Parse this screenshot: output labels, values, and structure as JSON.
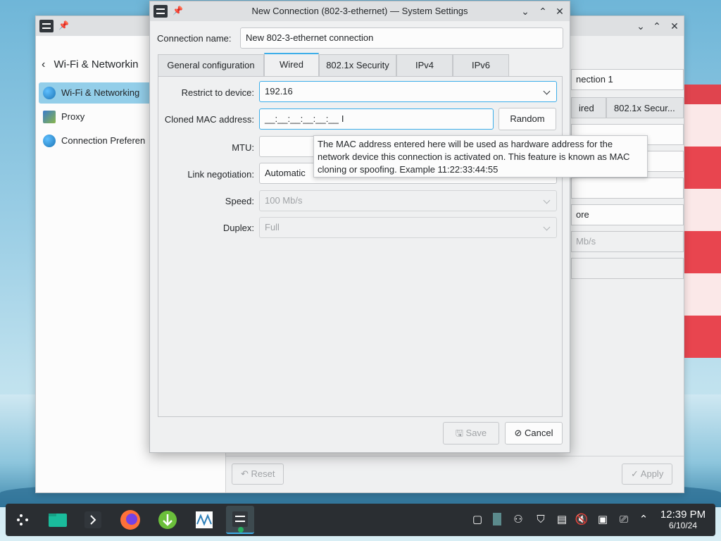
{
  "background_window": {
    "sidebar_title": "Wi-Fi & Networkin",
    "sidebar_items": [
      {
        "label": "Wi-Fi & Networking",
        "icon": "network-icon",
        "active": true
      },
      {
        "label": "Proxy",
        "icon": "proxy-icon",
        "active": false
      },
      {
        "label": "Connection Preferen",
        "icon": "globe-icon",
        "active": false
      }
    ],
    "right_peek": {
      "connection_name": "nection 1",
      "tab_wired": "ired",
      "tab_security": "802.1x Secur...",
      "field_more": "ore",
      "speed": "Mb/s"
    },
    "reset_label": "Reset",
    "apply_label": "Apply"
  },
  "dialog": {
    "title": "New Connection (802-3-ethernet) — System Settings",
    "connection_name_label": "Connection name:",
    "connection_name_value": "New 802-3-ethernet connection",
    "tabs": [
      {
        "label": "General configuration",
        "active": false
      },
      {
        "label": "Wired",
        "active": true
      },
      {
        "label": "802.1x Security",
        "active": false
      },
      {
        "label": "IPv4",
        "active": false
      },
      {
        "label": "IPv6",
        "active": false
      }
    ],
    "restrict_label": "Restrict to device:",
    "restrict_value": "192.16",
    "cloned_mac_label": "Cloned MAC address:",
    "cloned_mac_value": "__:__:__:__:__:__",
    "random_label": "Random",
    "mtu_label": "MTU:",
    "mtu_value": "",
    "link_negotiation_label": "Link negotiation:",
    "link_negotiation_value": "Automatic",
    "speed_label": "Speed:",
    "speed_value": "100 Mb/s",
    "duplex_label": "Duplex:",
    "duplex_value": "Full",
    "tooltip": "The MAC address entered here will be used as hardware address for the network device this connection is activated on. This feature is known as MAC cloning or spoofing. Example 11:22:33:44:55",
    "save_label": "Save",
    "cancel_label": "Cancel"
  },
  "taskbar": {
    "clock_time": "12:39 PM",
    "clock_date": "6/10/24"
  },
  "colors": {
    "accent": "#3daee9",
    "selection": "#93cee9",
    "taskbar": "#2a2e32"
  }
}
